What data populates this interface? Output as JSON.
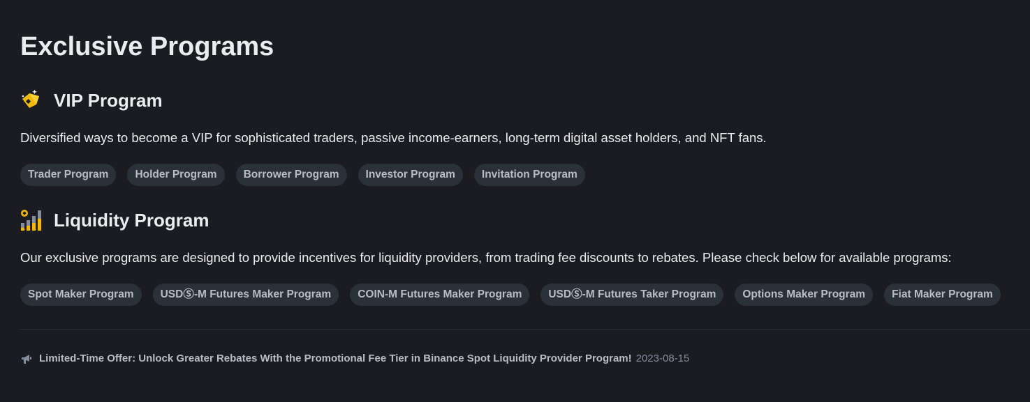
{
  "page": {
    "title": "Exclusive Programs"
  },
  "colors": {
    "background": "#1b1c21",
    "text": "#eaecef",
    "chip_bg": "#2b3139",
    "chip_text": "#b7bdc6",
    "accent_yellow": "#f0b90b",
    "muted": "#848e9c"
  },
  "vip": {
    "icon": "vip-diamond-tag-icon",
    "title": "VIP Program",
    "description": "Diversified ways to become a VIP for sophisticated traders, passive income-earners, long-term digital asset holders, and NFT fans.",
    "chips": [
      "Trader Program",
      "Holder Program",
      "Borrower Program",
      "Investor Program",
      "Invitation Program"
    ]
  },
  "liquidity": {
    "icon": "liquidity-bar-chart-icon",
    "title": "Liquidity Program",
    "description": "Our exclusive programs are designed to provide incentives for liquidity providers, from trading fee discounts to rebates. Please check below for available programs:",
    "chips": [
      "Spot Maker Program",
      "USDⓈ-M Futures Maker Program",
      "COIN-M Futures Maker Program",
      "USDⓈ-M Futures Taker Program",
      "Options Maker Program",
      "Fiat Maker Program"
    ]
  },
  "announcement": {
    "icon": "megaphone-icon",
    "text": "Limited-Time Offer: Unlock Greater Rebates With the Promotional Fee Tier in Binance Spot Liquidity Provider Program!",
    "date": "2023-08-15"
  }
}
